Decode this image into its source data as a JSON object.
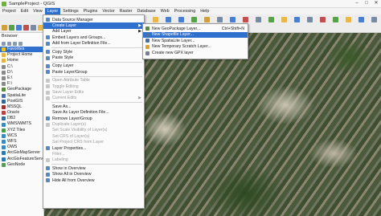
{
  "window": {
    "title": "SampleProject - QGIS"
  },
  "menubar": [
    "Project",
    "Edit",
    "View",
    "Layer",
    "Settings",
    "Plugins",
    "Vector",
    "Raster",
    "Database",
    "Web",
    "Processing",
    "Help"
  ],
  "browser": {
    "title": "Browser",
    "items": [
      {
        "label": "Favorites",
        "icon": "star-icon",
        "selected": true
      },
      {
        "label": "Project Home",
        "icon": "folder-icon"
      },
      {
        "label": "Home",
        "icon": "folder-icon"
      },
      {
        "label": "C:\\",
        "icon": "drive-icon"
      },
      {
        "label": "D:\\",
        "icon": "drive-icon"
      },
      {
        "label": "E:\\",
        "icon": "drive-icon"
      },
      {
        "label": "F:\\",
        "icon": "drive-icon"
      },
      {
        "label": "GeoPackage",
        "icon": "geopackage-icon"
      },
      {
        "label": "SpatiaLite",
        "icon": "spatialite-icon"
      },
      {
        "label": "PostGIS",
        "icon": "postgis-icon"
      },
      {
        "label": "MSSQL",
        "icon": "mssql-icon"
      },
      {
        "label": "Oracle",
        "icon": "oracle-icon"
      },
      {
        "label": "DB2",
        "icon": "db2-icon"
      },
      {
        "label": "WMS/WMTS",
        "icon": "wms-icon"
      },
      {
        "label": "XYZ Tiles",
        "icon": "xyz-icon"
      },
      {
        "label": "WCS",
        "icon": "wcs-icon"
      },
      {
        "label": "WFS",
        "icon": "wfs-icon"
      },
      {
        "label": "OWS",
        "icon": "ows-icon"
      },
      {
        "label": "ArcGisMapServer",
        "icon": "arcgis-icon"
      },
      {
        "label": "ArcGisFeatureServer",
        "icon": "arcgis-icon"
      },
      {
        "label": "GeoNode",
        "icon": "geonode-icon"
      }
    ]
  },
  "layer_menu": [
    {
      "label": "Data Source Manager",
      "icon": "data-source-icon"
    },
    {
      "label": "Create Layer",
      "icon": "",
      "submenu": true,
      "highlighted": true
    },
    {
      "label": "Add Layer",
      "icon": "",
      "submenu": true
    },
    {
      "label": "Embed Layers and Groups...",
      "icon": "embed-icon"
    },
    {
      "label": "Add from Layer Definition File...",
      "icon": "layer-definition-icon"
    },
    {
      "sep": true
    },
    {
      "label": "Copy Style",
      "icon": "copy-style-icon"
    },
    {
      "label": "Paste Style",
      "icon": "paste-style-icon"
    },
    {
      "sep": true
    },
    {
      "label": "Copy Layer",
      "icon": "copy-layer-icon"
    },
    {
      "label": "Paste Layer/Group",
      "icon": "paste-layer-icon"
    },
    {
      "sep": true
    },
    {
      "label": "Open Attribute Table",
      "icon": "attribute-table-icon",
      "disabled": true
    },
    {
      "label": "Toggle Editing",
      "icon": "edit-icon",
      "disabled": true
    },
    {
      "label": "Save Layer Edits",
      "icon": "save-edits-icon",
      "disabled": true
    },
    {
      "label": "Current Edits",
      "icon": "current-edits-icon",
      "disabled": true,
      "submenu": true
    },
    {
      "sep": true
    },
    {
      "label": "Save As...",
      "icon": "",
      "disabled": false
    },
    {
      "label": "Save As Layer Definition File...",
      "icon": ""
    },
    {
      "label": "Remove Layer/Group",
      "icon": "remove-layer-icon"
    },
    {
      "label": "Duplicate Layer(s)",
      "icon": "duplicate-icon",
      "disabled": true
    },
    {
      "label": "Set Scale Visibility of Layer(s)",
      "icon": "",
      "disabled": true
    },
    {
      "label": "Set CRS of Layer(s)",
      "icon": "",
      "disabled": true
    },
    {
      "label": "Set Project CRS from Layer",
      "icon": "",
      "disabled": true
    },
    {
      "label": "Layer Properties...",
      "icon": "properties-icon"
    },
    {
      "label": "Filter...",
      "icon": "",
      "disabled": true
    },
    {
      "label": "Labeling",
      "icon": "labeling-icon",
      "disabled": true
    },
    {
      "sep": true
    },
    {
      "label": "Show in Overview",
      "icon": "show-overview-icon"
    },
    {
      "label": "Show All in Overview",
      "icon": "show-all-overview-icon"
    },
    {
      "label": "Hide All from Overview",
      "icon": "hide-all-overview-icon"
    }
  ],
  "create_layer_submenu": [
    {
      "label": "New GeoPackage Layer...",
      "shortcut": "Ctrl+Shift+N",
      "icon": "geopackage-icon"
    },
    {
      "label": "New Shapefile Layer...",
      "shortcut": "",
      "icon": "shapefile-icon",
      "highlighted": true
    },
    {
      "label": "New SpatiaLite Layer...",
      "shortcut": "",
      "icon": "spatialite-icon"
    },
    {
      "label": "New Temporary Scratch Layer...",
      "shortcut": "",
      "icon": "scratch-layer-icon"
    },
    {
      "label": "Create new GPX layer",
      "shortcut": "",
      "icon": "gpx-icon"
    }
  ],
  "colors": {
    "highlight": "#2f6fce"
  }
}
